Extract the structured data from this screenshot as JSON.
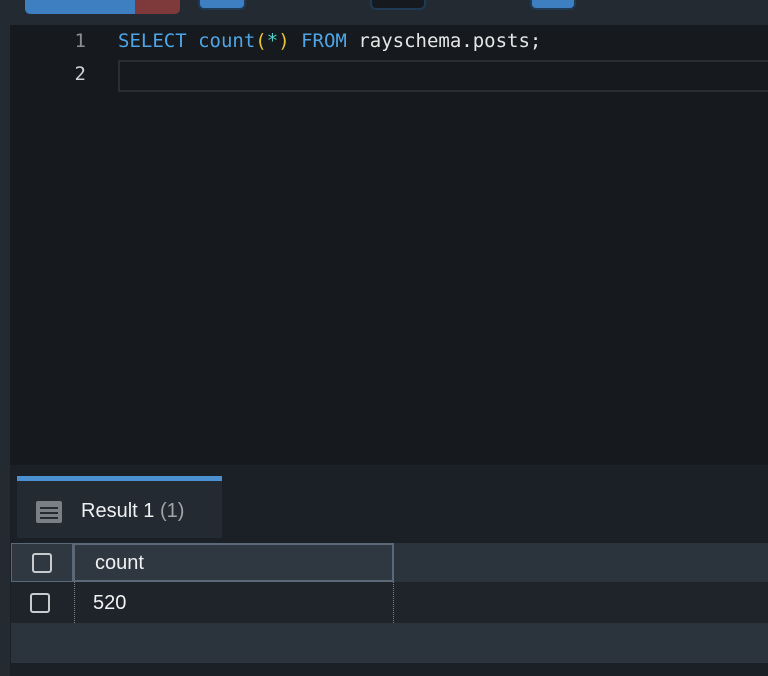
{
  "editor": {
    "lines": [
      {
        "number": "1",
        "tokens": {
          "select": "SELECT",
          "fn": "count",
          "open": "(",
          "star": "*",
          "close": ")",
          "from": "FROM",
          "rest": "rayschema.posts;"
        }
      },
      {
        "number": "2",
        "text": ""
      }
    ]
  },
  "results": {
    "tab": {
      "label": "Result 1",
      "count": "(1)"
    },
    "columns": [
      "count"
    ],
    "rows": [
      [
        "520"
      ]
    ]
  }
}
